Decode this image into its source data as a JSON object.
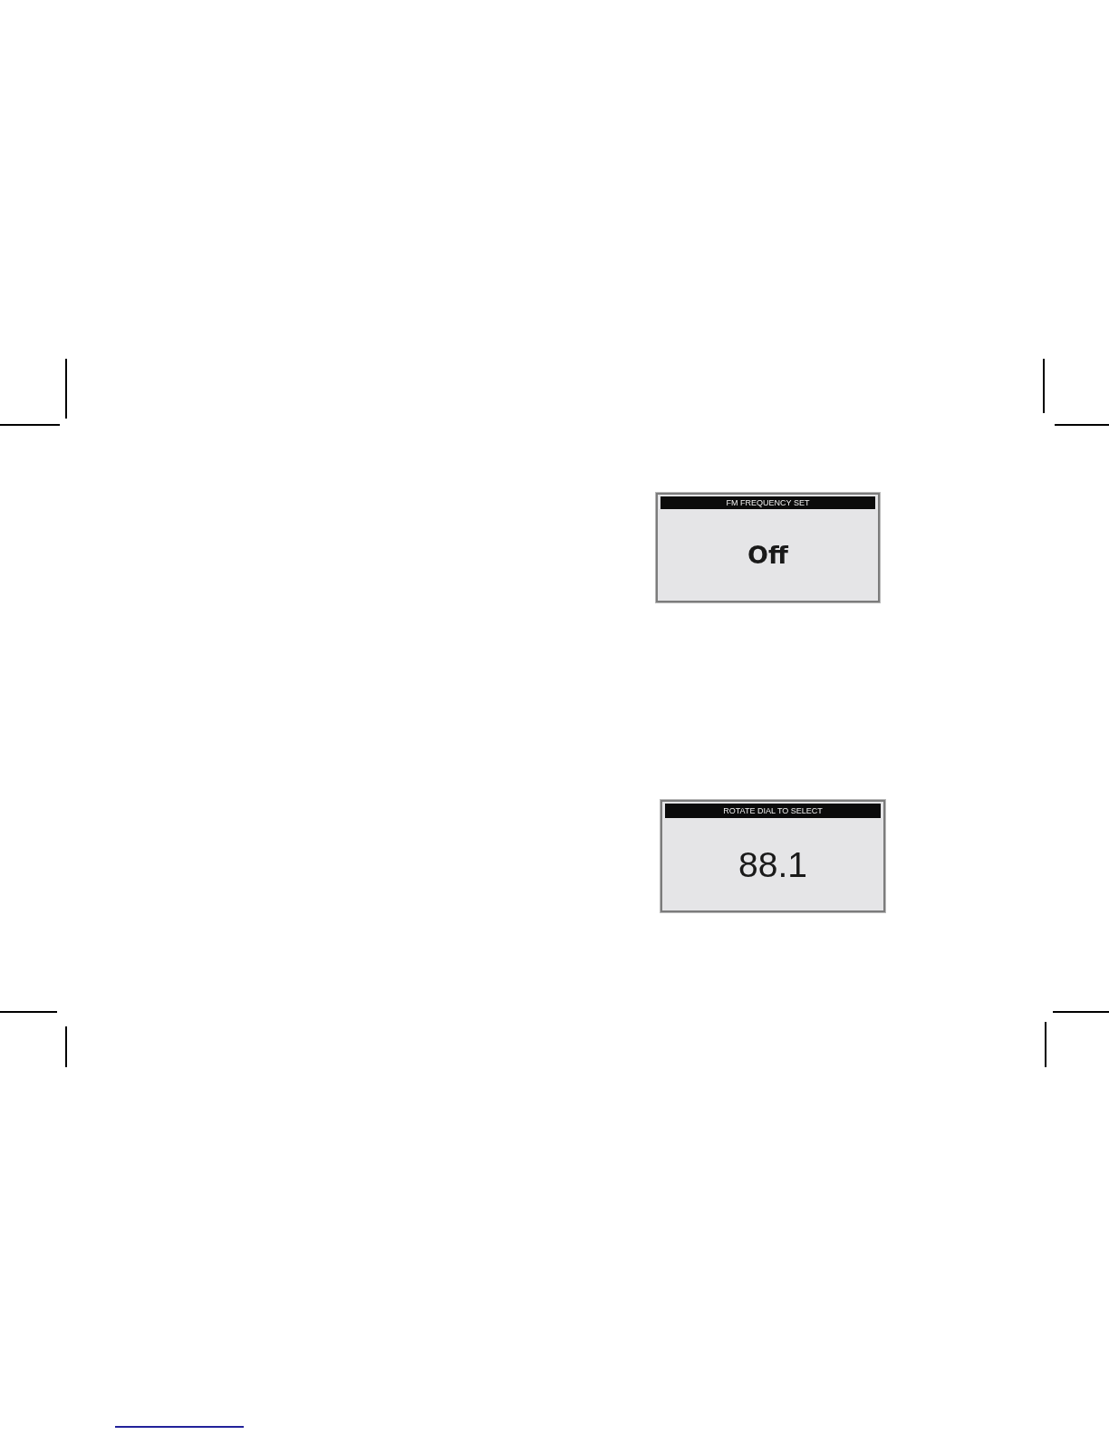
{
  "screens": [
    {
      "header": "FM FREQUENCY SET",
      "value": "Off"
    },
    {
      "header": "ROTATE DIAL TO SELECT",
      "value": "88.1"
    }
  ]
}
